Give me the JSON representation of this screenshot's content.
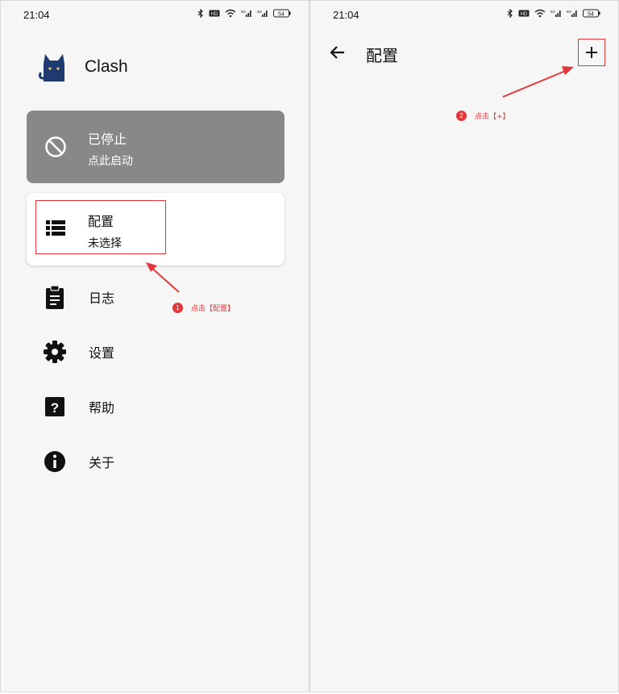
{
  "left": {
    "status": {
      "time": "21:04",
      "battery": "54"
    },
    "app": {
      "title": "Clash"
    },
    "stopped_card": {
      "title": "已停止",
      "subtitle": "点此启动"
    },
    "config_card": {
      "title": "配置",
      "subtitle": "未选择"
    },
    "menu": [
      {
        "label": "日志",
        "icon": "clipboard-icon"
      },
      {
        "label": "设置",
        "icon": "gear-icon"
      },
      {
        "label": "帮助",
        "icon": "help-icon"
      },
      {
        "label": "关于",
        "icon": "info-icon"
      }
    ],
    "annotation": {
      "number": "1",
      "text": "点击【配置】"
    }
  },
  "right": {
    "status": {
      "time": "21:04",
      "battery": "54"
    },
    "title": "配置",
    "annotation": {
      "number": "2",
      "text": "点击【+】"
    }
  },
  "colors": {
    "accent": "#e0383b",
    "stopped": "#888888",
    "app_logo": "#1f3a6e"
  }
}
